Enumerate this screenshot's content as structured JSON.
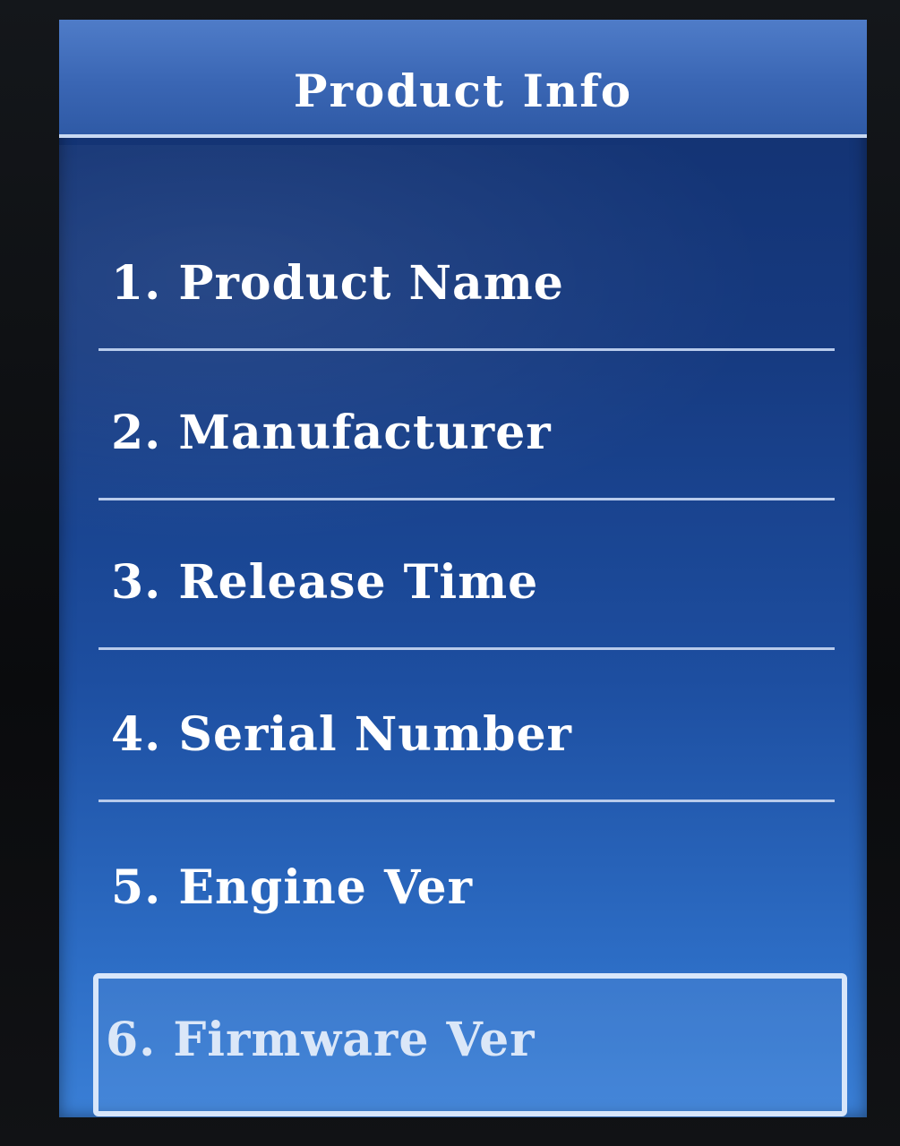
{
  "header": {
    "title": "Product Info"
  },
  "menu": {
    "items": [
      {
        "label": "1. Product Name"
      },
      {
        "label": "2. Manufacturer"
      },
      {
        "label": "3. Release Time"
      },
      {
        "label": "4. Serial Number"
      },
      {
        "label": "5. Engine Ver"
      },
      {
        "label": "6. Firmware Ver"
      }
    ],
    "selected_index": 5
  },
  "colors": {
    "screen_background": "#1d4ea0",
    "title_bar": "#3a66b4",
    "text": "#ffffff",
    "selection_border": "#d8e6fa"
  }
}
